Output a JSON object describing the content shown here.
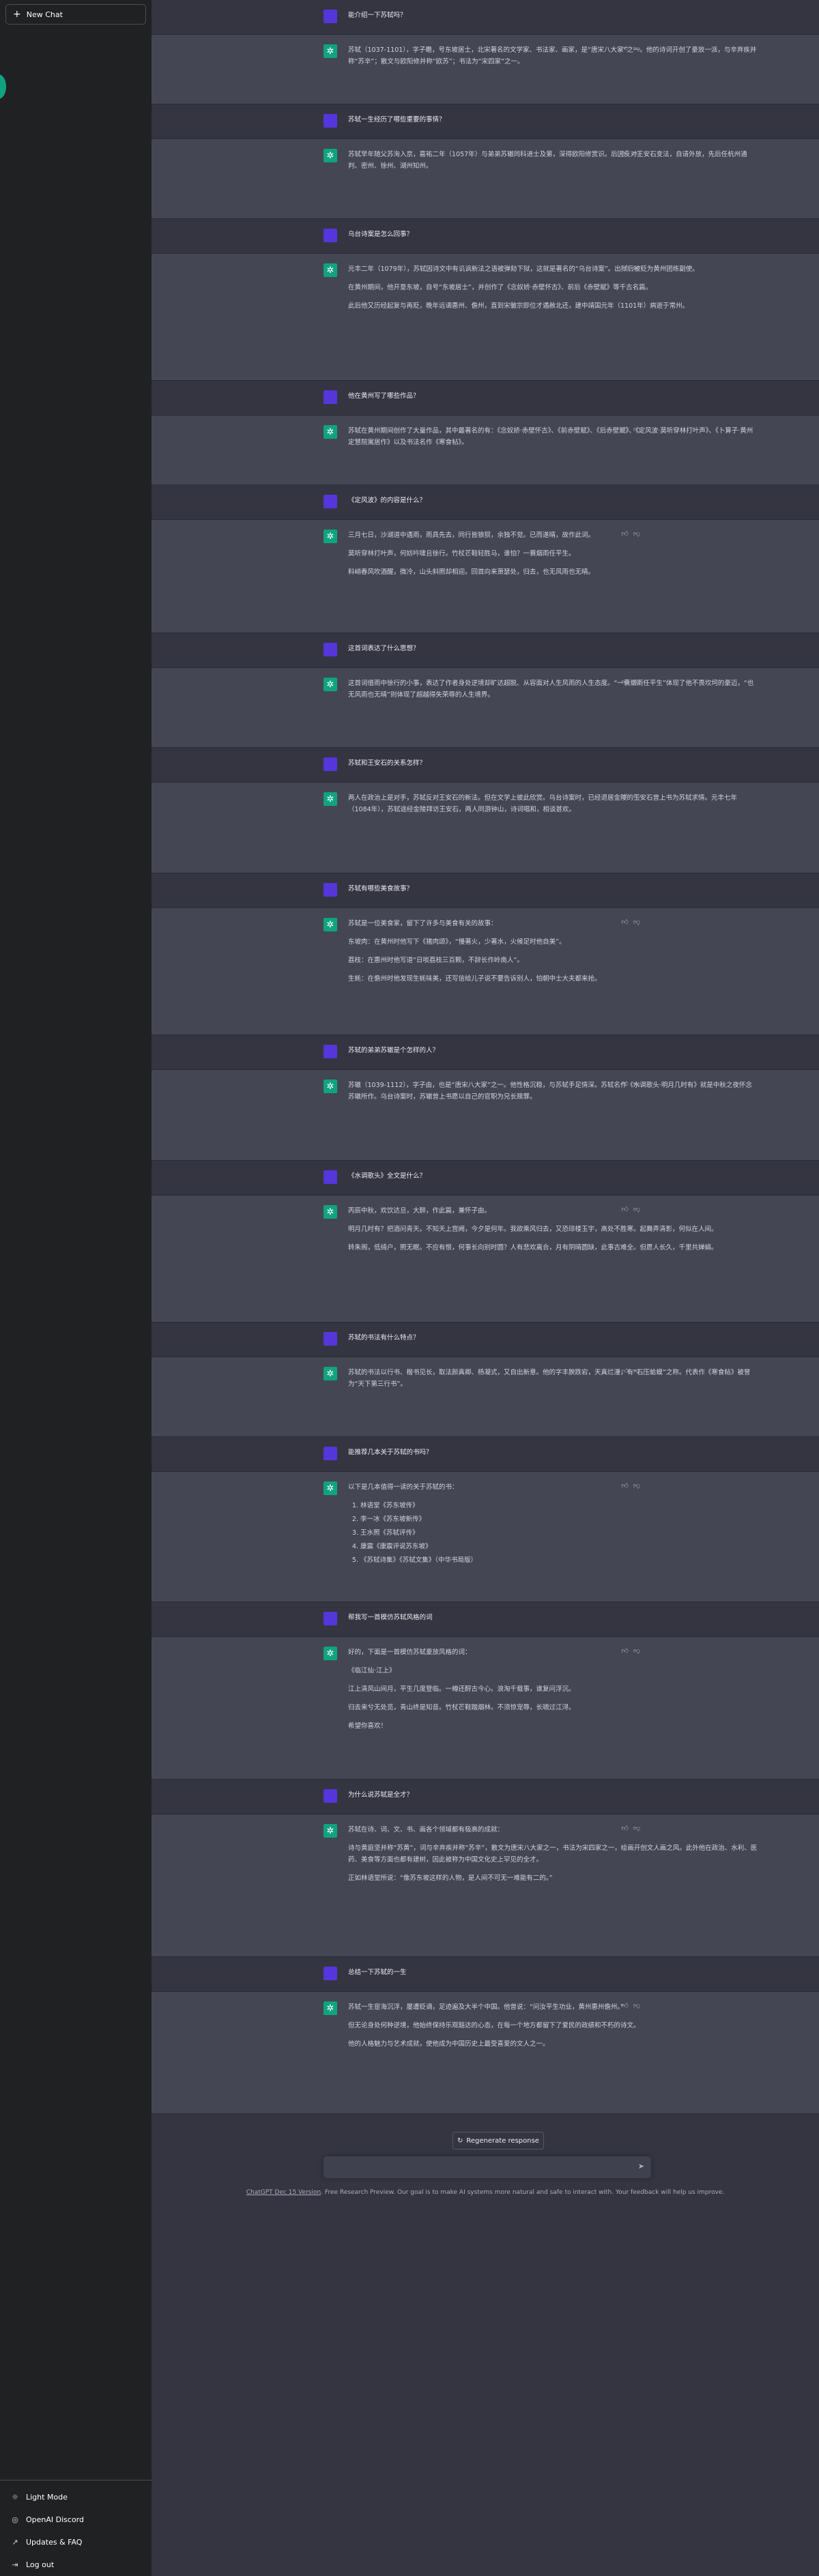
{
  "sidebar": {
    "new_chat": "New Chat",
    "plus_icon": "+",
    "bottom": [
      {
        "icon": "sun-icon",
        "glyph": "☼",
        "label": "Light Mode"
      },
      {
        "icon": "discord-icon",
        "glyph": "◎",
        "label": "OpenAI Discord"
      },
      {
        "icon": "external-link-icon",
        "glyph": "↗",
        "label": "Updates & FAQ"
      },
      {
        "icon": "logout-icon",
        "glyph": "⇥",
        "label": "Log out"
      }
    ]
  },
  "messages": [
    {
      "role": "user",
      "paras": [
        "能介绍一下苏轼吗？"
      ]
    },
    {
      "role": "bot",
      "paras": [
        "苏轼（1037-1101），字子瞻，号东坡居士，北宋著名的文学家、书法家、画家，是“唐宋八大家”之一。他的诗词开创了豪放一派，与辛弃疾并称“苏辛”；散文与欧阳修并称“欧苏”；书法为“宋四家”之一。"
      ]
    },
    {
      "role": "user",
      "paras": [
        "苏轼一生经历了哪些重要的事情？"
      ]
    },
    {
      "role": "bot",
      "paras": [
        "苏轼早年随父苏洵入京，嘉祐二年（1057年）与弟弟苏辙同科进士及第，深得欧阳修赏识。后因反对王安石变法，自请外放，先后任杭州通判、密州、徐州、湖州知州。"
      ]
    },
    {
      "role": "user",
      "paras": [
        "乌台诗案是怎么回事？"
      ]
    },
    {
      "role": "bot",
      "paras": [
        "元丰二年（1079年），苏轼因诗文中有讥讽新法之语被弹劾下狱，这就是著名的“乌台诗案”。出狱后被贬为黄州团练副使。",
        "在黄州期间，他开垦东坡，自号“东坡居士”，并创作了《念奴娇·赤壁怀古》、前后《赤壁赋》等千古名篇。",
        "此后他又历经起复与再贬，晚年远谪惠州、儋州，直到宋徽宗即位才遇赦北还，建中靖国元年（1101年）病逝于常州。"
      ]
    },
    {
      "role": "user",
      "paras": [
        "他在黄州写了哪些作品？"
      ]
    },
    {
      "role": "bot",
      "paras": [
        "苏轼在黄州期间创作了大量作品，其中最著名的有：《念奴娇·赤壁怀古》、《前赤壁赋》、《后赤壁赋》、《定风波·莫听穿林打叶声》、《卜算子·黄州定慧院寓居作》以及书法名作《寒食帖》。"
      ]
    },
    {
      "role": "user",
      "paras": [
        "《定风波》的内容是什么？"
      ]
    },
    {
      "role": "bot",
      "paras": [
        "三月七日，沙湖道中遇雨，雨具先去，同行皆狼狈，余独不觉。已而遂晴，故作此词。",
        "莫听穿林打叶声，何妨吟啸且徐行。竹杖芒鞋轻胜马，谁怕？一蓑烟雨任平生。",
        "料峭春风吹酒醒，微冷，山头斜照却相迎。回首向来萧瑟处，归去，也无风雨也无晴。"
      ]
    },
    {
      "role": "user",
      "paras": [
        "这首词表达了什么思想？"
      ]
    },
    {
      "role": "bot",
      "paras": [
        "这首词借雨中徐行的小事，表达了作者身处逆境却旷达超脱、从容面对人生风雨的人生态度。“一蓑烟雨任平生”体现了他不畏坎坷的豪迈，“也无风雨也无晴”则体现了超越得失荣辱的人生境界。"
      ]
    },
    {
      "role": "user",
      "paras": [
        "苏轼和王安石的关系怎样？"
      ]
    },
    {
      "role": "bot",
      "paras": [
        "两人在政治上是对手，苏轼反对王安石的新法。但在文学上彼此欣赏。乌台诗案时，已经退居金陵的王安石曾上书为苏轼求情。元丰七年（1084年），苏轼途经金陵拜访王安石，两人同游钟山，诗词唱和，相谈甚欢。"
      ]
    },
    {
      "role": "user",
      "paras": [
        "苏轼有哪些美食故事？"
      ]
    },
    {
      "role": "bot",
      "paras": [
        "苏轼是一位美食家，留下了许多与美食有关的故事：",
        "东坡肉：在黄州时他写下《猪肉颂》，“慢著火，少著水，火候足时他自美”。",
        "荔枝：在惠州时他写道“日啖荔枝三百颗，不辞长作岭南人”。",
        "生蚝：在儋州时他发现生蚝味美，还写信给儿子说不要告诉别人，怕朝中士大夫都来抢。"
      ]
    },
    {
      "role": "user",
      "paras": [
        "苏轼的弟弟苏辙是个怎样的人？"
      ]
    },
    {
      "role": "bot",
      "paras": [
        "苏辙（1039-1112），字子由，也是“唐宋八大家”之一。他性格沉稳，与苏轼手足情深。苏轼名作《水调歌头·明月几时有》就是中秋之夜怀念苏辙所作。乌台诗案时，苏辙曾上书愿以自己的官职为兄长赎罪。"
      ]
    },
    {
      "role": "user",
      "paras": [
        "《水调歌头》全文是什么？"
      ]
    },
    {
      "role": "bot",
      "paras": [
        "丙辰中秋，欢饮达旦，大醉，作此篇，兼怀子由。",
        "明月几时有？把酒问青天。不知天上宫阙，今夕是何年。我欲乘风归去，又恐琼楼玉宇，高处不胜寒。起舞弄清影，何似在人间。",
        "转朱阁，低绮户，照无眠。不应有恨，何事长向别时圆？人有悲欢离合，月有阴晴圆缺，此事古难全。但愿人长久，千里共婵娟。"
      ]
    },
    {
      "role": "user",
      "paras": [
        "苏轼的书法有什么特点？"
      ]
    },
    {
      "role": "bot",
      "paras": [
        "苏轼的书法以行书、楷书见长，取法颜真卿、杨凝式，又自出新意。他的字丰腴跌宕，天真烂漫，有“石压蛤蟆”之称。代表作《寒食帖》被誉为“天下第三行书”。"
      ]
    },
    {
      "role": "user",
      "paras": [
        "能推荐几本关于苏轼的书吗？"
      ]
    },
    {
      "role": "bot",
      "paras": [
        "以下是几本值得一读的关于苏轼的书："
      ],
      "list": [
        "林语堂《苏东坡传》",
        "李一冰《苏东坡新传》",
        "王水照《苏轼评传》",
        "康震《康震评说苏东坡》",
        "《苏轼诗集》《苏轼文集》（中华书局版）"
      ]
    },
    {
      "role": "user",
      "paras": [
        "帮我写一首模仿苏轼风格的词"
      ]
    },
    {
      "role": "bot",
      "paras": [
        "好的，下面是一首模仿苏轼豪放风格的词：",
        "《临江仙·江上》",
        "江上清风山间月，平生几度登临。一樽还酹古今心。浪淘千载事，谁复问浮沉。",
        "归去来兮无处觅，青山终是知音。竹杖芒鞋踏烟林。不须惊宠辱，长啸过江浔。",
        "希望你喜欢！"
      ]
    },
    {
      "role": "user",
      "paras": [
        "为什么说苏轼是全才？"
      ]
    },
    {
      "role": "bot",
      "paras": [
        "苏轼在诗、词、文、书、画各个领域都有极高的成就：",
        "诗与黄庭坚并称“苏黄”，词与辛弃疾并称“苏辛”，散文为唐宋八大家之一，书法为宋四家之一，绘画开创文人画之风。此外他在政治、水利、医药、美食等方面也都有建树，因此被称为中国文化史上罕见的全才。",
        "正如林语堂所说：“像苏东坡这样的人物，是人间不可无一难能有二的。”"
      ]
    },
    {
      "role": "user",
      "paras": [
        "总结一下苏轼的一生"
      ]
    },
    {
      "role": "bot",
      "paras": [
        "苏轼一生宦海沉浮，屡遭贬谪，足迹遍及大半个中国。他曾说：“问汝平生功业，黄州惠州儋州。”",
        "但无论身处何种逆境，他始终保持乐观豁达的心态，在每一个地方都留下了爱民的政绩和不朽的诗文。",
        "他的人格魅力与艺术成就，使他成为中国历史上最受喜爱的文人之一。"
      ]
    }
  ],
  "regenerate": {
    "icon": "↻",
    "label": "Regenerate response"
  },
  "input": {
    "placeholder": "",
    "send_icon": "➤"
  },
  "footer": {
    "link": "ChatGPT Dec 15 Version",
    "text": ". Free Research Preview. Our goal is to make AI systems more natural and safe to interact with. Your feedback will help us improve."
  }
}
